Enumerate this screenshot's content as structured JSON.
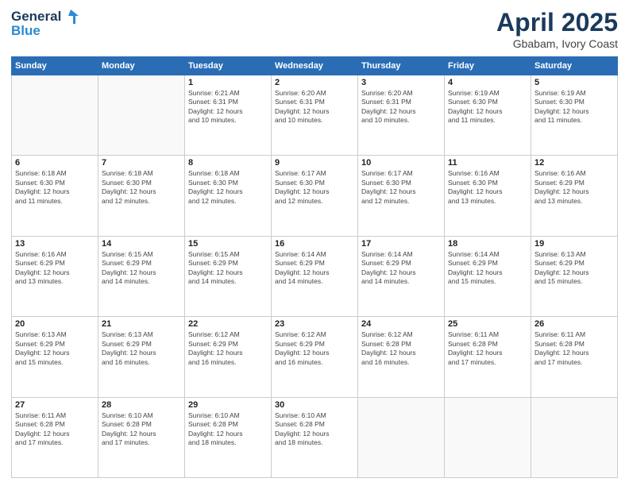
{
  "header": {
    "logo_line1": "General",
    "logo_line2": "Blue",
    "month_title": "April 2025",
    "location": "Gbabam, Ivory Coast"
  },
  "days_of_week": [
    "Sunday",
    "Monday",
    "Tuesday",
    "Wednesday",
    "Thursday",
    "Friday",
    "Saturday"
  ],
  "weeks": [
    [
      {
        "day": "",
        "info": ""
      },
      {
        "day": "",
        "info": ""
      },
      {
        "day": "1",
        "info": "Sunrise: 6:21 AM\nSunset: 6:31 PM\nDaylight: 12 hours\nand 10 minutes."
      },
      {
        "day": "2",
        "info": "Sunrise: 6:20 AM\nSunset: 6:31 PM\nDaylight: 12 hours\nand 10 minutes."
      },
      {
        "day": "3",
        "info": "Sunrise: 6:20 AM\nSunset: 6:31 PM\nDaylight: 12 hours\nand 10 minutes."
      },
      {
        "day": "4",
        "info": "Sunrise: 6:19 AM\nSunset: 6:30 PM\nDaylight: 12 hours\nand 11 minutes."
      },
      {
        "day": "5",
        "info": "Sunrise: 6:19 AM\nSunset: 6:30 PM\nDaylight: 12 hours\nand 11 minutes."
      }
    ],
    [
      {
        "day": "6",
        "info": "Sunrise: 6:18 AM\nSunset: 6:30 PM\nDaylight: 12 hours\nand 11 minutes."
      },
      {
        "day": "7",
        "info": "Sunrise: 6:18 AM\nSunset: 6:30 PM\nDaylight: 12 hours\nand 12 minutes."
      },
      {
        "day": "8",
        "info": "Sunrise: 6:18 AM\nSunset: 6:30 PM\nDaylight: 12 hours\nand 12 minutes."
      },
      {
        "day": "9",
        "info": "Sunrise: 6:17 AM\nSunset: 6:30 PM\nDaylight: 12 hours\nand 12 minutes."
      },
      {
        "day": "10",
        "info": "Sunrise: 6:17 AM\nSunset: 6:30 PM\nDaylight: 12 hours\nand 12 minutes."
      },
      {
        "day": "11",
        "info": "Sunrise: 6:16 AM\nSunset: 6:30 PM\nDaylight: 12 hours\nand 13 minutes."
      },
      {
        "day": "12",
        "info": "Sunrise: 6:16 AM\nSunset: 6:29 PM\nDaylight: 12 hours\nand 13 minutes."
      }
    ],
    [
      {
        "day": "13",
        "info": "Sunrise: 6:16 AM\nSunset: 6:29 PM\nDaylight: 12 hours\nand 13 minutes."
      },
      {
        "day": "14",
        "info": "Sunrise: 6:15 AM\nSunset: 6:29 PM\nDaylight: 12 hours\nand 14 minutes."
      },
      {
        "day": "15",
        "info": "Sunrise: 6:15 AM\nSunset: 6:29 PM\nDaylight: 12 hours\nand 14 minutes."
      },
      {
        "day": "16",
        "info": "Sunrise: 6:14 AM\nSunset: 6:29 PM\nDaylight: 12 hours\nand 14 minutes."
      },
      {
        "day": "17",
        "info": "Sunrise: 6:14 AM\nSunset: 6:29 PM\nDaylight: 12 hours\nand 14 minutes."
      },
      {
        "day": "18",
        "info": "Sunrise: 6:14 AM\nSunset: 6:29 PM\nDaylight: 12 hours\nand 15 minutes."
      },
      {
        "day": "19",
        "info": "Sunrise: 6:13 AM\nSunset: 6:29 PM\nDaylight: 12 hours\nand 15 minutes."
      }
    ],
    [
      {
        "day": "20",
        "info": "Sunrise: 6:13 AM\nSunset: 6:29 PM\nDaylight: 12 hours\nand 15 minutes."
      },
      {
        "day": "21",
        "info": "Sunrise: 6:13 AM\nSunset: 6:29 PM\nDaylight: 12 hours\nand 16 minutes."
      },
      {
        "day": "22",
        "info": "Sunrise: 6:12 AM\nSunset: 6:29 PM\nDaylight: 12 hours\nand 16 minutes."
      },
      {
        "day": "23",
        "info": "Sunrise: 6:12 AM\nSunset: 6:29 PM\nDaylight: 12 hours\nand 16 minutes."
      },
      {
        "day": "24",
        "info": "Sunrise: 6:12 AM\nSunset: 6:28 PM\nDaylight: 12 hours\nand 16 minutes."
      },
      {
        "day": "25",
        "info": "Sunrise: 6:11 AM\nSunset: 6:28 PM\nDaylight: 12 hours\nand 17 minutes."
      },
      {
        "day": "26",
        "info": "Sunrise: 6:11 AM\nSunset: 6:28 PM\nDaylight: 12 hours\nand 17 minutes."
      }
    ],
    [
      {
        "day": "27",
        "info": "Sunrise: 6:11 AM\nSunset: 6:28 PM\nDaylight: 12 hours\nand 17 minutes."
      },
      {
        "day": "28",
        "info": "Sunrise: 6:10 AM\nSunset: 6:28 PM\nDaylight: 12 hours\nand 17 minutes."
      },
      {
        "day": "29",
        "info": "Sunrise: 6:10 AM\nSunset: 6:28 PM\nDaylight: 12 hours\nand 18 minutes."
      },
      {
        "day": "30",
        "info": "Sunrise: 6:10 AM\nSunset: 6:28 PM\nDaylight: 12 hours\nand 18 minutes."
      },
      {
        "day": "",
        "info": ""
      },
      {
        "day": "",
        "info": ""
      },
      {
        "day": "",
        "info": ""
      }
    ]
  ]
}
